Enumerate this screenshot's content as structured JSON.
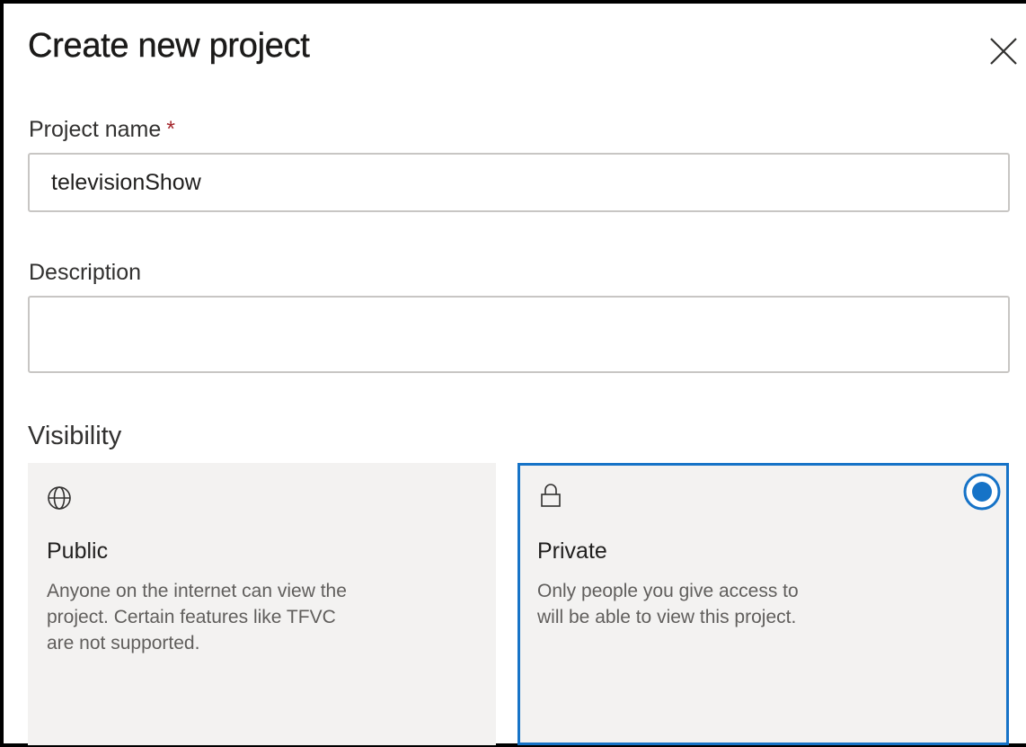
{
  "dialog": {
    "title": "Create new project"
  },
  "icons": {
    "close": "close-icon",
    "public": "globe-icon",
    "private": "lock-icon",
    "selected": "radio-selected-icon"
  },
  "fields": {
    "project_name": {
      "label": "Project name",
      "required_mark": "*",
      "value": "televisionShow"
    },
    "description": {
      "label": "Description",
      "value": ""
    }
  },
  "visibility": {
    "label": "Visibility",
    "selected": "private",
    "options": [
      {
        "id": "public",
        "title": "Public",
        "description": "Anyone on the internet can view the project. Certain features like TFVC are not supported."
      },
      {
        "id": "private",
        "title": "Private",
        "description": "Only people you give access to will be able to view this project."
      }
    ]
  },
  "colors": {
    "accent": "#1673c7",
    "required": "#a4262c",
    "card_background": "#f3f2f1",
    "input_border": "#c8c6c4"
  }
}
